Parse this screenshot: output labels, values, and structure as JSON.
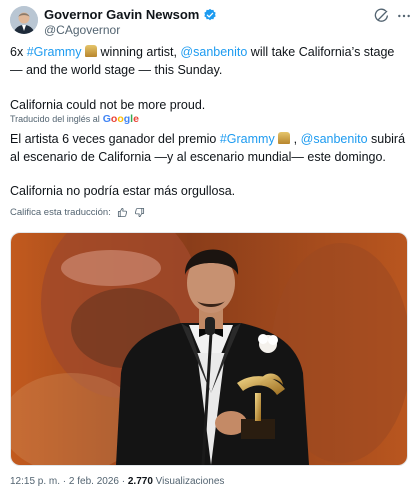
{
  "author": {
    "display_name": "Governor Gavin Newsom",
    "handle": "@CAgovernor"
  },
  "tweet": {
    "p1": {
      "pre": "6x ",
      "hashtag": "#Grammy",
      "mid": " winning artist, ",
      "mention": "@sanbenito",
      "post": " will take California’s stage — and the world stage — this Sunday."
    },
    "p2": "California could not be more proud."
  },
  "translation": {
    "label": "Traducido del inglés al",
    "provider": "Google",
    "p1": {
      "pre": "El artista 6 veces ganador del premio ",
      "hashtag": "#Grammy",
      "mid": " , ",
      "mention": "@sanbenito",
      "post": " subirá al escenario de California —y al escenario mundial— este domingo."
    },
    "p2": "California no podría estar más orgullosa.",
    "rate_label": "Califica esta traducción:"
  },
  "meta": {
    "time": "12:15 p. m.",
    "separator": " · ",
    "date": "2 feb. 2026",
    "views_count": "2.770",
    "views_label": "Visualizaciones"
  },
  "icons": {
    "verified": "verified-badge-icon",
    "grok": "grok-icon",
    "more": "more-options-icon",
    "thumbs_up": "thumbs-up-icon",
    "thumbs_down": "thumbs-down-icon",
    "grammy": "grammy-trophy-emoji"
  },
  "colors": {
    "link": "#1d9bf0",
    "verified": "#1d9bf0",
    "text": "#0f1419",
    "secondary": "#536471"
  }
}
